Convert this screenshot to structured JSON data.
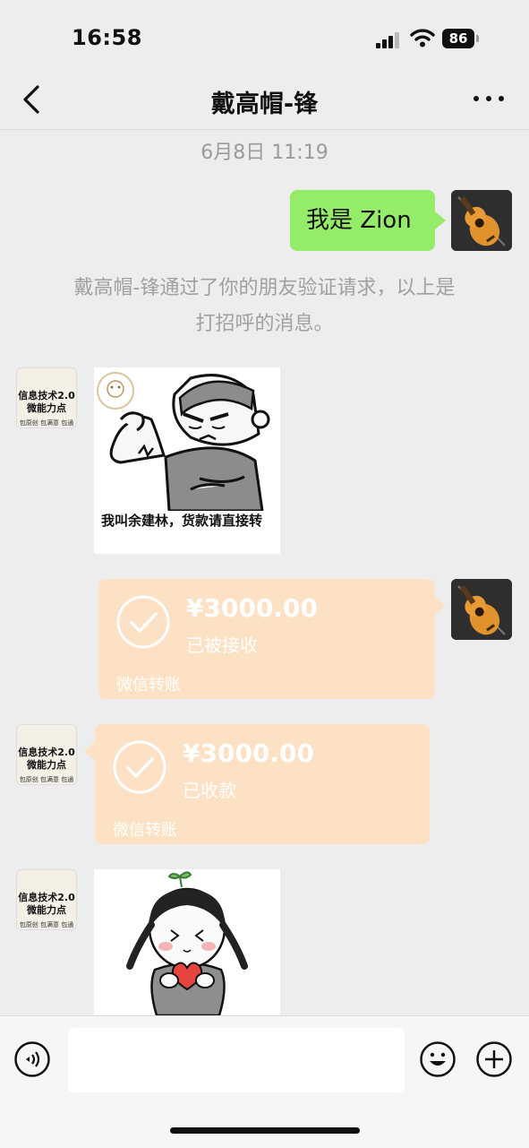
{
  "status_bar": {
    "time": "16:58",
    "battery": "86"
  },
  "nav": {
    "title": "戴高帽-锋"
  },
  "chat": {
    "timestamp": "6月8日 11:19",
    "messages": {
      "me_text": "我是 Zion",
      "system_line1": "戴高帽-锋通过了你的朋友验证请求，以上是",
      "system_line2": "打招呼的消息。",
      "sticker1_caption": "我叫余建林，货款请直接转",
      "transfer_sent": {
        "amount": "¥3000.00",
        "status": "已被接收",
        "label": "微信转账"
      },
      "transfer_received": {
        "amount": "¥3000.00",
        "status": "已收款",
        "label": "微信转账"
      }
    }
  },
  "contact_avatar": {
    "top": "信息技术2.0微能力点",
    "line1": "信息技术2.0",
    "line2": "微能力点",
    "bottom": "包原创 包满意 包通过"
  },
  "colors": {
    "bubble_me": "#95ec69",
    "transfer": "#fce1c4",
    "background": "#ededed"
  },
  "icons": [
    "signal-icon",
    "wifi-icon",
    "battery-icon",
    "back-icon",
    "more-icon",
    "voice-icon",
    "emoji-icon",
    "plus-icon",
    "check-icon"
  ]
}
